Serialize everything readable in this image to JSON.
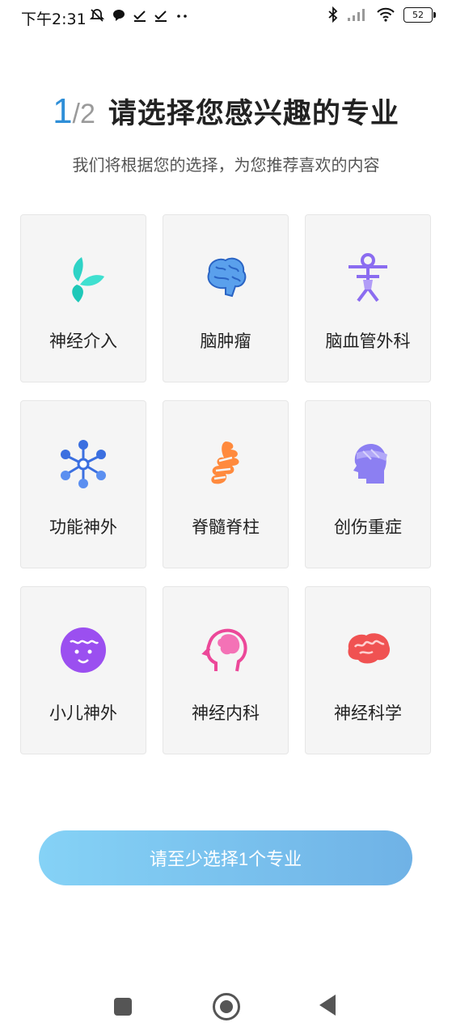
{
  "status_bar": {
    "time": "下午2:31",
    "battery": "52",
    "left_icons": [
      "mute-bell-icon",
      "chat-bubble-icon",
      "check-icon",
      "check-icon",
      "more-dots-icon"
    ],
    "right_icons": [
      "bluetooth-icon",
      "signal-icon",
      "wifi-icon",
      "battery-icon"
    ]
  },
  "header": {
    "step_current": "1",
    "step_total": "/2",
    "title": "请选择您感兴趣的专业",
    "subtitle": "我们将根据您的选择，为您推荐喜欢的内容"
  },
  "specialties": [
    {
      "label": "神经介入",
      "icon": "leaf-icon",
      "color": "#2ed3c6"
    },
    {
      "label": "脑肿瘤",
      "icon": "brain-icon",
      "color": "#4a90e2"
    },
    {
      "label": "脑血管外科",
      "icon": "vessel-figure-icon",
      "color": "#8b6cf0"
    },
    {
      "label": "功能神外",
      "icon": "network-icon",
      "color": "#3b6fe0"
    },
    {
      "label": "脊髓脊柱",
      "icon": "spine-icon",
      "color": "#ff8a3d"
    },
    {
      "label": "创伤重症",
      "icon": "head-bandage-icon",
      "color": "#7a6ff0"
    },
    {
      "label": "小儿神外",
      "icon": "baby-face-icon",
      "color": "#a855f7"
    },
    {
      "label": "神经内科",
      "icon": "head-brain-icon",
      "color": "#ec4899"
    },
    {
      "label": "神经科学",
      "icon": "brain-red-icon",
      "color": "#f05252"
    }
  ],
  "submit": {
    "label": "请至少选择1个专业"
  },
  "nav": {
    "icons": [
      "recent-apps-icon",
      "home-icon",
      "back-icon"
    ]
  }
}
